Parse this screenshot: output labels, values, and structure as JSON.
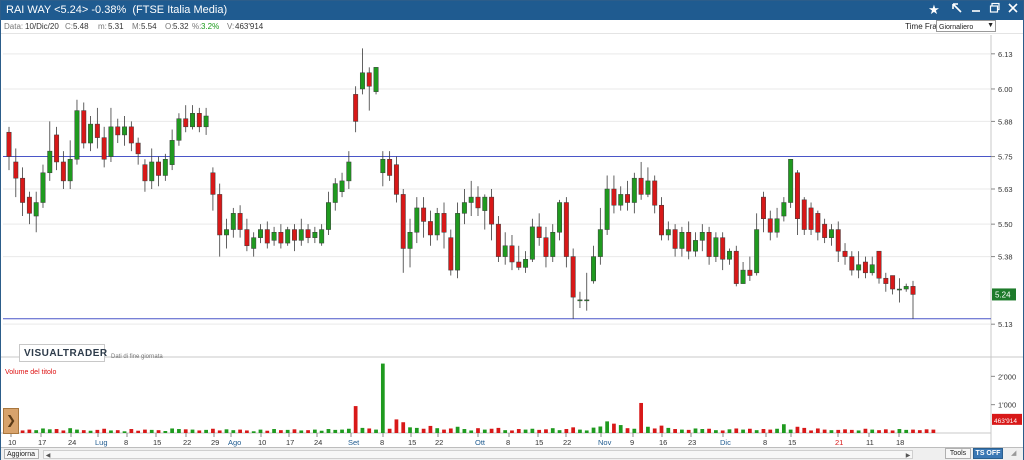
{
  "titlebar": {
    "title": "RAI WAY <5.24> -0.38%  (FTSE Italia Media)",
    "icons": [
      "star-icon",
      "arrow-icon",
      "minimize-icon",
      "restore-icon",
      "close-icon"
    ]
  },
  "info": {
    "date_label": "Data:",
    "date_value": "10/Dic/20",
    "close_label": "C:",
    "close_value": "5.48",
    "min_label": "m:",
    "min_value": "5.31",
    "max_label": "M:",
    "max_value": "5.54",
    "open_label": "O:",
    "open_value": "5.32",
    "pct_label": "%:",
    "pct_value": "3.2%",
    "vol_label": "V:",
    "vol_value": "463'914",
    "timeframe_label": "Time Frame",
    "timeframe_value": "Giornaliero"
  },
  "price_axis": {
    "ticks": [
      "6.13",
      "6.00",
      "5.88",
      "5.75",
      "5.63",
      "5.50",
      "5.38",
      "5.24",
      "5.13"
    ],
    "current_value": "5.24"
  },
  "volume_axis": {
    "ticks": [
      "2'000",
      "1'000"
    ],
    "current_value": "463'914"
  },
  "x_axis": {
    "labels": [
      "10",
      "17",
      "24",
      "Lug",
      "8",
      "15",
      "22",
      "29",
      "Ago",
      "10",
      "17",
      "24",
      "Set",
      "8",
      "15",
      "22",
      "Ott",
      "8",
      "15",
      "22",
      "Nov",
      "9",
      "16",
      "23",
      "Dic",
      "8",
      "15",
      "21",
      "11",
      "18"
    ]
  },
  "logo": {
    "brand": "VISUALTRADER",
    "subtitle": "Dati di fine giornata"
  },
  "volume_panel": {
    "label": "Volume del titolo"
  },
  "bottombar": {
    "aggiorna": "Aggiorna",
    "tools": "Tools",
    "tsoff": "TS OFF"
  },
  "colors": {
    "up": "#1f9a1f",
    "down": "#d81818",
    "line": "#4a56c8",
    "titlebar": "#1f5b90",
    "price_badge": "#1e7b2b"
  },
  "chart_data": {
    "type": "candlestick",
    "title": "RAI WAY",
    "price_ylim": [
      5.09,
      6.17
    ],
    "volume_ylim": [
      0,
      2400
    ],
    "horizontal_lines": [
      5.75,
      5.15
    ],
    "candles": [
      {
        "o": 5.84,
        "c": 5.75,
        "h": 5.86,
        "l": 5.7
      },
      {
        "o": 5.73,
        "c": 5.67,
        "h": 5.78,
        "l": 5.6
      },
      {
        "o": 5.67,
        "c": 5.58,
        "h": 5.71,
        "l": 5.53
      },
      {
        "o": 5.6,
        "c": 5.54,
        "h": 5.62,
        "l": 5.5
      },
      {
        "o": 5.53,
        "c": 5.58,
        "h": 5.62,
        "l": 5.47
      },
      {
        "o": 5.58,
        "c": 5.69,
        "h": 5.72,
        "l": 5.56
      },
      {
        "o": 5.69,
        "c": 5.77,
        "h": 5.88,
        "l": 5.66
      },
      {
        "o": 5.83,
        "c": 5.73,
        "h": 5.86,
        "l": 5.7
      },
      {
        "o": 5.73,
        "c": 5.66,
        "h": 5.77,
        "l": 5.63
      },
      {
        "o": 5.66,
        "c": 5.74,
        "h": 5.81,
        "l": 5.63
      },
      {
        "o": 5.74,
        "c": 5.92,
        "h": 5.96,
        "l": 5.72
      },
      {
        "o": 5.92,
        "c": 5.8,
        "h": 5.95,
        "l": 5.78
      },
      {
        "o": 5.8,
        "c": 5.87,
        "h": 5.9,
        "l": 5.77
      },
      {
        "o": 5.87,
        "c": 5.82,
        "h": 5.93,
        "l": 5.78
      },
      {
        "o": 5.82,
        "c": 5.74,
        "h": 5.86,
        "l": 5.71
      },
      {
        "o": 5.75,
        "c": 5.86,
        "h": 5.93,
        "l": 5.73
      },
      {
        "o": 5.86,
        "c": 5.83,
        "h": 5.89,
        "l": 5.8
      },
      {
        "o": 5.83,
        "c": 5.86,
        "h": 5.9,
        "l": 5.79
      },
      {
        "o": 5.86,
        "c": 5.8,
        "h": 5.88,
        "l": 5.77
      },
      {
        "o": 5.8,
        "c": 5.76,
        "h": 5.82,
        "l": 5.72
      },
      {
        "o": 5.72,
        "c": 5.66,
        "h": 5.74,
        "l": 5.62
      },
      {
        "o": 5.66,
        "c": 5.73,
        "h": 5.78,
        "l": 5.63
      },
      {
        "o": 5.73,
        "c": 5.68,
        "h": 5.75,
        "l": 5.64
      },
      {
        "o": 5.68,
        "c": 5.74,
        "h": 5.76,
        "l": 5.66
      },
      {
        "o": 5.72,
        "c": 5.81,
        "h": 5.85,
        "l": 5.7
      },
      {
        "o": 5.81,
        "c": 5.89,
        "h": 5.91,
        "l": 5.79
      },
      {
        "o": 5.89,
        "c": 5.86,
        "h": 5.94,
        "l": 5.84
      },
      {
        "o": 5.86,
        "c": 5.91,
        "h": 5.94,
        "l": 5.85
      },
      {
        "o": 5.91,
        "c": 5.86,
        "h": 5.93,
        "l": 5.84
      },
      {
        "o": 5.86,
        "c": 5.9,
        "h": 5.93,
        "l": 5.83
      },
      {
        "o": 5.69,
        "c": 5.61,
        "h": 5.71,
        "l": 5.55
      },
      {
        "o": 5.61,
        "c": 5.46,
        "h": 5.65,
        "l": 5.38
      },
      {
        "o": 5.46,
        "c": 5.48,
        "h": 5.52,
        "l": 5.41
      },
      {
        "o": 5.48,
        "c": 5.54,
        "h": 5.56,
        "l": 5.45
      },
      {
        "o": 5.54,
        "c": 5.48,
        "h": 5.57,
        "l": 5.45
      },
      {
        "o": 5.48,
        "c": 5.42,
        "h": 5.52,
        "l": 5.4
      },
      {
        "o": 5.41,
        "c": 5.45,
        "h": 5.47,
        "l": 5.38
      },
      {
        "o": 5.45,
        "c": 5.48,
        "h": 5.5,
        "l": 5.43
      },
      {
        "o": 5.48,
        "c": 5.43,
        "h": 5.51,
        "l": 5.41
      },
      {
        "o": 5.44,
        "c": 5.47,
        "h": 5.49,
        "l": 5.42
      },
      {
        "o": 5.47,
        "c": 5.43,
        "h": 5.5,
        "l": 5.41
      },
      {
        "o": 5.43,
        "c": 5.48,
        "h": 5.49,
        "l": 5.42
      },
      {
        "o": 5.48,
        "c": 5.44,
        "h": 5.5,
        "l": 5.4
      },
      {
        "o": 5.44,
        "c": 5.48,
        "h": 5.52,
        "l": 5.42
      },
      {
        "o": 5.48,
        "c": 5.45,
        "h": 5.5,
        "l": 5.43
      },
      {
        "o": 5.45,
        "c": 5.47,
        "h": 5.49,
        "l": 5.43
      },
      {
        "o": 5.43,
        "c": 5.48,
        "h": 5.5,
        "l": 5.42
      },
      {
        "o": 5.48,
        "c": 5.58,
        "h": 5.62,
        "l": 5.46
      },
      {
        "o": 5.58,
        "c": 5.65,
        "h": 5.67,
        "l": 5.55
      },
      {
        "o": 5.62,
        "c": 5.66,
        "h": 5.69,
        "l": 5.6
      },
      {
        "o": 5.66,
        "c": 5.73,
        "h": 5.77,
        "l": 5.63
      },
      {
        "o": 5.98,
        "c": 5.88,
        "h": 6.01,
        "l": 5.84
      },
      {
        "o": 6.0,
        "c": 6.06,
        "h": 6.15,
        "l": 5.98
      },
      {
        "o": 6.06,
        "c": 6.01,
        "h": 6.08,
        "l": 5.92
      },
      {
        "o": 5.99,
        "c": 6.08,
        "h": 6.08,
        "l": 5.98
      },
      {
        "o": 5.69,
        "c": 5.74,
        "h": 5.77,
        "l": 5.64
      },
      {
        "o": 5.74,
        "c": 5.68,
        "h": 5.77,
        "l": 5.66
      },
      {
        "o": 5.72,
        "c": 5.61,
        "h": 5.75,
        "l": 5.58
      },
      {
        "o": 5.61,
        "c": 5.41,
        "h": 5.63,
        "l": 5.32
      },
      {
        "o": 5.41,
        "c": 5.47,
        "h": 5.52,
        "l": 5.34
      },
      {
        "o": 5.47,
        "c": 5.56,
        "h": 5.6,
        "l": 5.43
      },
      {
        "o": 5.56,
        "c": 5.51,
        "h": 5.6,
        "l": 5.45
      },
      {
        "o": 5.51,
        "c": 5.46,
        "h": 5.55,
        "l": 5.42
      },
      {
        "o": 5.46,
        "c": 5.54,
        "h": 5.56,
        "l": 5.44
      },
      {
        "o": 5.54,
        "c": 5.47,
        "h": 5.58,
        "l": 5.41
      },
      {
        "o": 5.45,
        "c": 5.33,
        "h": 5.48,
        "l": 5.31
      },
      {
        "o": 5.33,
        "c": 5.54,
        "h": 5.58,
        "l": 5.3
      },
      {
        "o": 5.54,
        "c": 5.58,
        "h": 5.63,
        "l": 5.5
      },
      {
        "o": 5.58,
        "c": 5.6,
        "h": 5.66,
        "l": 5.53
      },
      {
        "o": 5.6,
        "c": 5.56,
        "h": 5.64,
        "l": 5.53
      },
      {
        "o": 5.55,
        "c": 5.6,
        "h": 5.61,
        "l": 5.48
      },
      {
        "o": 5.6,
        "c": 5.5,
        "h": 5.63,
        "l": 5.44
      },
      {
        "o": 5.5,
        "c": 5.38,
        "h": 5.53,
        "l": 5.36
      },
      {
        "o": 5.38,
        "c": 5.42,
        "h": 5.47,
        "l": 5.35
      },
      {
        "o": 5.42,
        "c": 5.36,
        "h": 5.46,
        "l": 5.33
      },
      {
        "o": 5.36,
        "c": 5.34,
        "h": 5.42,
        "l": 5.33
      },
      {
        "o": 5.34,
        "c": 5.37,
        "h": 5.4,
        "l": 5.32
      },
      {
        "o": 5.37,
        "c": 5.49,
        "h": 5.52,
        "l": 5.36
      },
      {
        "o": 5.49,
        "c": 5.45,
        "h": 5.54,
        "l": 5.42
      },
      {
        "o": 5.45,
        "c": 5.38,
        "h": 5.49,
        "l": 5.34
      },
      {
        "o": 5.38,
        "c": 5.47,
        "h": 5.5,
        "l": 5.36
      },
      {
        "o": 5.47,
        "c": 5.58,
        "h": 5.59,
        "l": 5.44
      },
      {
        "o": 5.58,
        "c": 5.38,
        "h": 5.6,
        "l": 5.34
      },
      {
        "o": 5.38,
        "c": 5.23,
        "h": 5.41,
        "l": 5.15
      },
      {
        "o": 5.22,
        "c": 5.22,
        "h": 5.25,
        "l": 5.19
      },
      {
        "o": 5.22,
        "c": 5.22,
        "h": 5.32,
        "l": 5.18
      },
      {
        "o": 5.29,
        "c": 5.38,
        "h": 5.42,
        "l": 5.28
      },
      {
        "o": 5.38,
        "c": 5.48,
        "h": 5.56,
        "l": 5.35
      },
      {
        "o": 5.48,
        "c": 5.63,
        "h": 5.68,
        "l": 5.46
      },
      {
        "o": 5.63,
        "c": 5.57,
        "h": 5.68,
        "l": 5.54
      },
      {
        "o": 5.57,
        "c": 5.61,
        "h": 5.64,
        "l": 5.55
      },
      {
        "o": 5.61,
        "c": 5.58,
        "h": 5.66,
        "l": 5.55
      },
      {
        "o": 5.58,
        "c": 5.67,
        "h": 5.69,
        "l": 5.54
      },
      {
        "o": 5.67,
        "c": 5.61,
        "h": 5.73,
        "l": 5.59
      },
      {
        "o": 5.61,
        "c": 5.66,
        "h": 5.71,
        "l": 5.6
      },
      {
        "o": 5.66,
        "c": 5.57,
        "h": 5.68,
        "l": 5.54
      },
      {
        "o": 5.57,
        "c": 5.46,
        "h": 5.6,
        "l": 5.44
      },
      {
        "o": 5.46,
        "c": 5.48,
        "h": 5.51,
        "l": 5.44
      },
      {
        "o": 5.48,
        "c": 5.41,
        "h": 5.5,
        "l": 5.38
      },
      {
        "o": 5.41,
        "c": 5.47,
        "h": 5.49,
        "l": 5.38
      },
      {
        "o": 5.47,
        "c": 5.4,
        "h": 5.51,
        "l": 5.37
      },
      {
        "o": 5.4,
        "c": 5.44,
        "h": 5.47,
        "l": 5.38
      },
      {
        "o": 5.44,
        "c": 5.47,
        "h": 5.5,
        "l": 5.4
      },
      {
        "o": 5.47,
        "c": 5.38,
        "h": 5.49,
        "l": 5.35
      },
      {
        "o": 5.38,
        "c": 5.45,
        "h": 5.47,
        "l": 5.36
      },
      {
        "o": 5.45,
        "c": 5.37,
        "h": 5.47,
        "l": 5.33
      },
      {
        "o": 5.37,
        "c": 5.4,
        "h": 5.41,
        "l": 5.35
      },
      {
        "o": 5.4,
        "c": 5.28,
        "h": 5.42,
        "l": 5.27
      },
      {
        "o": 5.28,
        "c": 5.33,
        "h": 5.36,
        "l": 5.28
      },
      {
        "o": 5.33,
        "c": 5.31,
        "h": 5.38,
        "l": 5.29
      },
      {
        "o": 5.32,
        "c": 5.48,
        "h": 5.54,
        "l": 5.31
      },
      {
        "o": 5.6,
        "c": 5.52,
        "h": 5.62,
        "l": 5.47
      },
      {
        "o": 5.52,
        "c": 5.47,
        "h": 5.55,
        "l": 5.44
      },
      {
        "o": 5.47,
        "c": 5.52,
        "h": 5.56,
        "l": 5.45
      },
      {
        "o": 5.53,
        "c": 5.58,
        "h": 5.6,
        "l": 5.51
      },
      {
        "o": 5.58,
        "c": 5.74,
        "h": 5.74,
        "l": 5.56
      },
      {
        "o": 5.69,
        "c": 5.52,
        "h": 5.7,
        "l": 5.46
      },
      {
        "o": 5.59,
        "c": 5.48,
        "h": 5.6,
        "l": 5.46
      },
      {
        "o": 5.56,
        "c": 5.48,
        "h": 5.58,
        "l": 5.46
      },
      {
        "o": 5.54,
        "c": 5.47,
        "h": 5.55,
        "l": 5.44
      },
      {
        "o": 5.5,
        "c": 5.45,
        "h": 5.52,
        "l": 5.43
      },
      {
        "o": 5.45,
        "c": 5.48,
        "h": 5.5,
        "l": 5.42
      },
      {
        "o": 5.48,
        "c": 5.4,
        "h": 5.51,
        "l": 5.36
      },
      {
        "o": 5.4,
        "c": 5.38,
        "h": 5.43,
        "l": 5.35
      },
      {
        "o": 5.38,
        "c": 5.33,
        "h": 5.4,
        "l": 5.31
      },
      {
        "o": 5.33,
        "c": 5.35,
        "h": 5.4,
        "l": 5.3
      },
      {
        "o": 5.36,
        "c": 5.32,
        "h": 5.38,
        "l": 5.3
      },
      {
        "o": 5.32,
        "c": 5.35,
        "h": 5.38,
        "l": 5.31
      },
      {
        "o": 5.4,
        "c": 5.3,
        "h": 5.4,
        "l": 5.28
      },
      {
        "o": 5.3,
        "c": 5.28,
        "h": 5.32,
        "l": 5.25
      },
      {
        "o": 5.31,
        "c": 5.26,
        "h": 5.31,
        "l": 5.24
      },
      {
        "o": 5.26,
        "c": 5.26,
        "h": 5.3,
        "l": 5.21
      },
      {
        "o": 5.26,
        "c": 5.27,
        "h": 5.28,
        "l": 5.25
      },
      {
        "o": 5.27,
        "c": 5.24,
        "h": 5.29,
        "l": 5.15
      }
    ],
    "volumes": [
      160,
      110,
      90,
      120,
      100,
      160,
      130,
      140,
      90,
      170,
      120,
      100,
      80,
      110,
      150,
      90,
      100,
      60,
      140,
      80,
      120,
      110,
      100,
      70,
      160,
      140,
      130,
      120,
      90,
      110,
      150,
      90,
      130,
      100,
      120,
      90,
      60,
      120,
      80,
      140,
      100,
      110,
      130,
      90,
      100,
      120,
      80,
      140,
      110,
      120,
      150,
      950,
      180,
      160,
      120,
      2450,
      150,
      480,
      380,
      200,
      180,
      150,
      250,
      170,
      120,
      160,
      220,
      140,
      90,
      170,
      120,
      150,
      180,
      100,
      90,
      140,
      120,
      150,
      110,
      130,
      170,
      100,
      140,
      200,
      120,
      90,
      190,
      230,
      410,
      330,
      280,
      170,
      150,
      1060,
      220,
      160,
      260,
      180,
      140,
      120,
      110,
      160,
      140,
      150,
      100,
      90,
      130,
      160,
      120,
      150,
      100,
      140,
      120,
      150,
      310,
      120,
      220,
      180,
      90,
      160,
      120,
      100,
      110,
      130,
      110,
      90,
      150,
      120,
      100,
      130,
      90,
      140,
      110,
      120,
      100,
      130,
      120
    ],
    "volume_colors": "alternating red/green by close vs open"
  }
}
